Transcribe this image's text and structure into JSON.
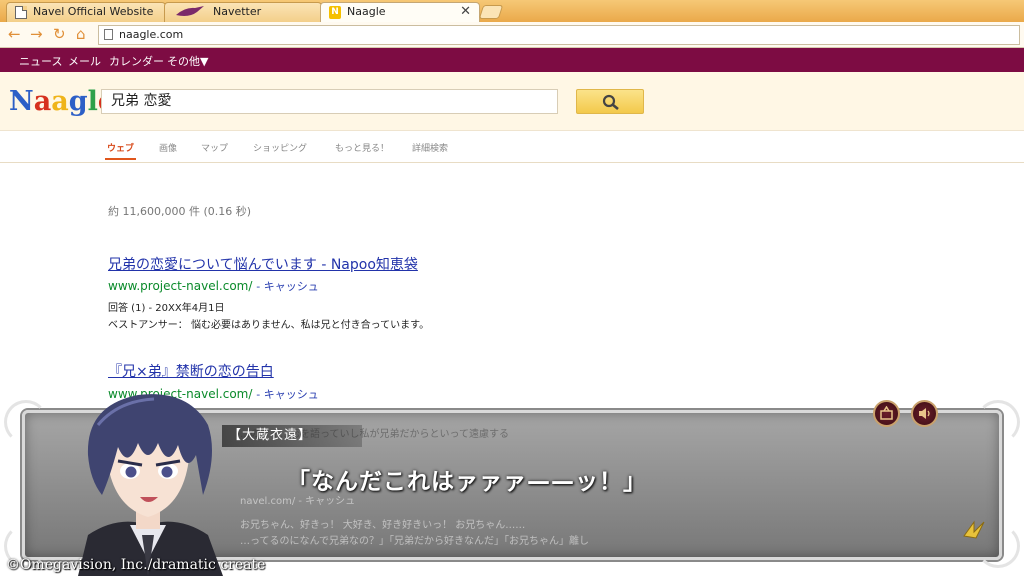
{
  "browser": {
    "tabs": [
      {
        "label": "Navel  Official  Website",
        "icon": "page-icon"
      },
      {
        "label": "Navetter",
        "icon": "bird-icon"
      },
      {
        "label": "Naagle",
        "icon": "naagle-n-icon",
        "badge": "N",
        "active": true
      }
    ],
    "close_glyph": "✕",
    "address": "naagle.com"
  },
  "gbar": {
    "items": [
      "ニュース",
      "メール",
      "カレンダー",
      "その他▼"
    ]
  },
  "search": {
    "logo": [
      "N",
      "a",
      "a",
      "g",
      "l",
      "e"
    ],
    "logo_colors": [
      "#2d5fc7",
      "#d6311e",
      "#efb41a",
      "#2d5fc7",
      "#2ea04a",
      "#d6311e"
    ],
    "query": "兄弟  恋愛",
    "button_icon": "search-icon"
  },
  "tabs": [
    "ウェブ",
    "画像",
    "マップ",
    "ショッピング",
    "もっと見る！",
    "詳細検索"
  ],
  "stats": "約  11,600,000  件  (0.16  秒)",
  "results": [
    {
      "title": "兄弟の恋愛について悩んでいます  -  Napoo知恵袋",
      "url": "www.project-navel.com/",
      "cache": "- キャッシュ",
      "meta": "回答 (1)   -  20XX年4月1日",
      "snippet": "ベストアンサー： 悩む必要はありません、私は兄と付き合っています。"
    },
    {
      "title": "『兄×弟』禁断の恋の告白",
      "url": "www.project-navel.com/",
      "cache": "- キャッシュ"
    }
  ],
  "faded_lines": [
    "…のタイ…恋を語っていし私が兄弟だからといって遠慮する",
    "お兄ちゃん、好きっ！  大好き、好き好きいっ！  お兄ちゃん……",
    "…ってるのになんで兄弟なの？」「兄弟だから好きなんだ」「お兄ちゃん」離し"
  ],
  "faded_url": "navel.com/  - キャッシュ",
  "dialogue": {
    "speaker": "【大蔵衣遠】",
    "line": "「なんだこれはァァァ——ッ！」"
  },
  "copyright": "©Omegavision, Inc./dramatic create",
  "accent": "#7d0c43"
}
